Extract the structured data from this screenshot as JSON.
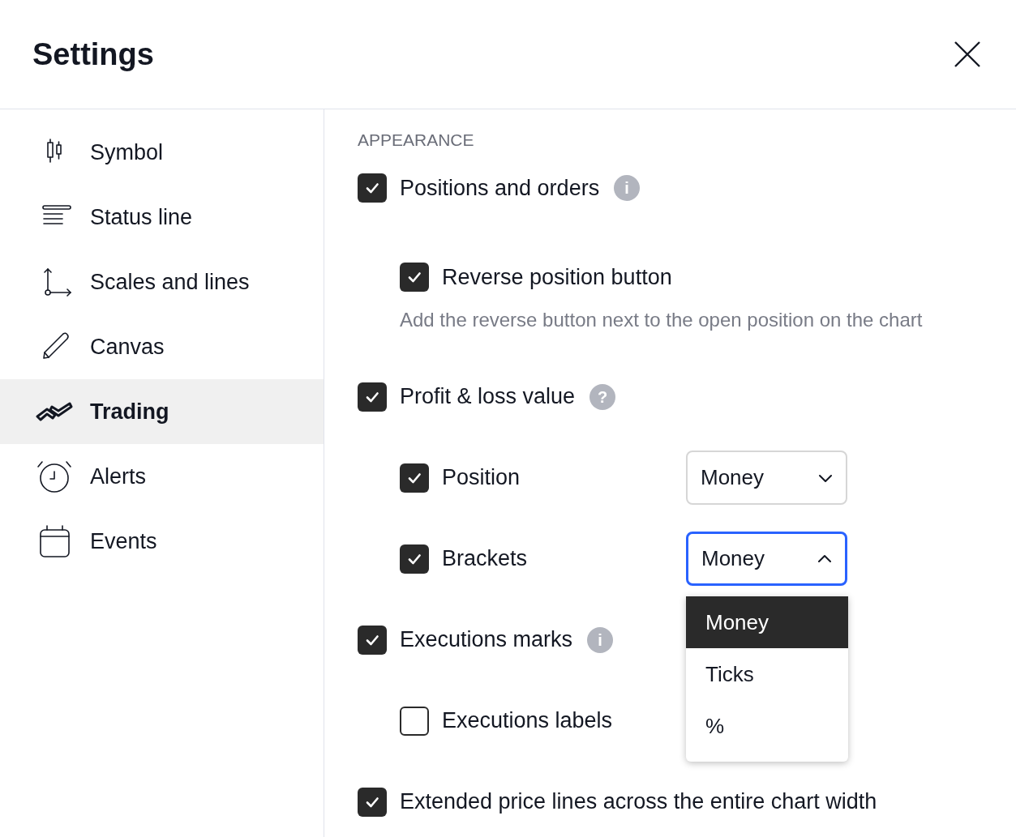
{
  "title": "Settings",
  "sidebar": {
    "items": [
      {
        "label": "Symbol",
        "selected": false
      },
      {
        "label": "Status line",
        "selected": false
      },
      {
        "label": "Scales and lines",
        "selected": false
      },
      {
        "label": "Canvas",
        "selected": false
      },
      {
        "label": "Trading",
        "selected": true
      },
      {
        "label": "Alerts",
        "selected": false
      },
      {
        "label": "Events",
        "selected": false
      }
    ]
  },
  "section": "APPEARANCE",
  "options": [
    {
      "kind": "top",
      "label": "Positions and orders",
      "checked": true,
      "hint": "i"
    },
    {
      "kind": "sub",
      "label": "Reverse position button",
      "checked": true,
      "description": "Add the reverse button next to the open position on the chart"
    },
    {
      "kind": "top",
      "label": "Profit & loss value",
      "checked": true,
      "hint": "?"
    },
    {
      "kind": "sub",
      "label": "Position",
      "checked": true,
      "select": {
        "value": "Money",
        "open": false
      }
    },
    {
      "kind": "sub",
      "label": "Brackets",
      "checked": true,
      "select": {
        "value": "Money",
        "open": true,
        "options": [
          {
            "label": "Money",
            "selected": true
          },
          {
            "label": "Ticks",
            "selected": false
          },
          {
            "label": "%",
            "selected": false
          }
        ]
      }
    },
    {
      "kind": "top",
      "label": "Executions marks",
      "checked": true,
      "hint": "i"
    },
    {
      "kind": "sub",
      "label": "Executions labels",
      "checked": false
    },
    {
      "kind": "top",
      "label": "Extended price lines across the entire chart width",
      "checked": true
    }
  ]
}
